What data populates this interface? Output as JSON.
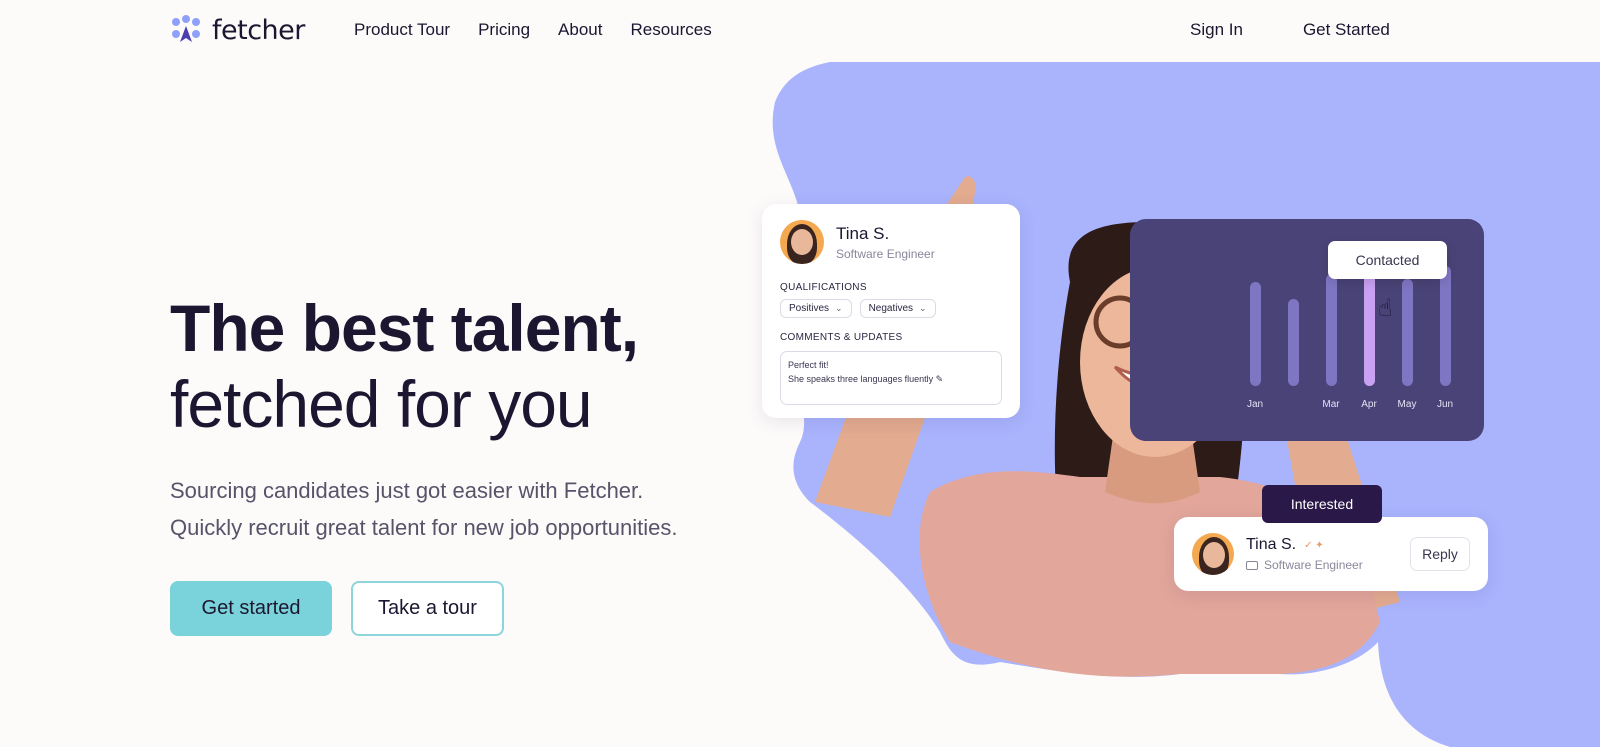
{
  "nav": {
    "logo_text": "fetcher",
    "links": [
      "Product Tour",
      "Pricing",
      "About",
      "Resources"
    ],
    "sign_in": "Sign In",
    "get_started": "Get Started"
  },
  "hero": {
    "headline_bold": "The best talent,",
    "headline_regular": "fetched for you",
    "subtitle_line1": "Sourcing candidates just got easier with Fetcher.",
    "subtitle_line2": "Quickly recruit great talent for new job opportunities.",
    "primary_cta": "Get started",
    "secondary_cta": "Take a tour"
  },
  "profile_card": {
    "name": "Tina S.",
    "role": "Software Engineer",
    "qualifications_label": "QUALIFICATIONS",
    "chip_positives": "Positives",
    "chip_negatives": "Negatives",
    "comments_label": "COMMENTS & UPDATES",
    "comment_line1": "Perfect fit!",
    "comment_line2": "She speaks three languages fluently ✎"
  },
  "chart_card": {
    "months": [
      "Jan",
      "Mar",
      "Apr",
      "May",
      "Jun"
    ],
    "tooltip": "Contacted"
  },
  "reply_card": {
    "badge": "Interested",
    "name": "Tina S.",
    "role": "Software Engineer",
    "reply_label": "Reply"
  },
  "colors": {
    "blob": "#a9b4fd",
    "accent_teal": "#7ad3da",
    "chart_bg": "#4a4377",
    "interested_bg": "#2a1848"
  }
}
